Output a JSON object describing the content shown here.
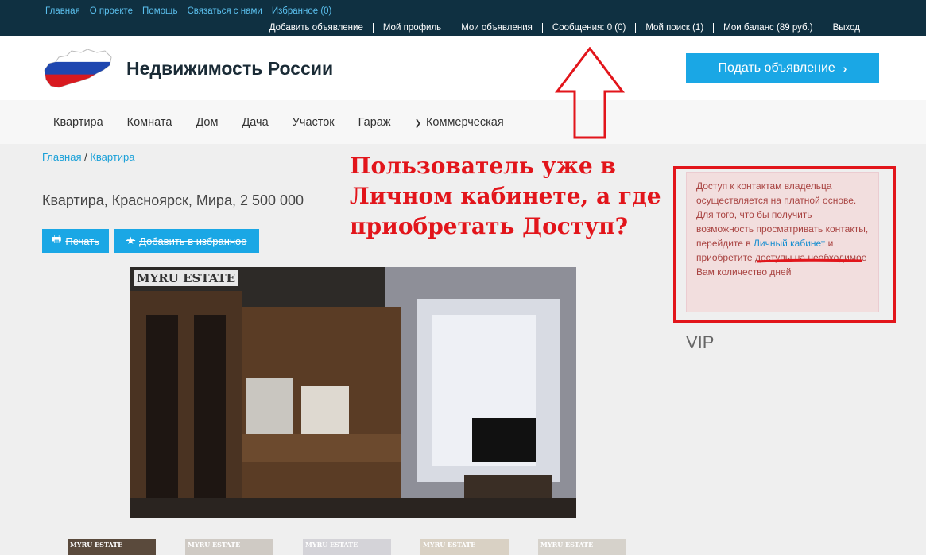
{
  "topbar": {
    "links": [
      "Главная",
      "О проекте",
      "Помощь",
      "Связаться с нами",
      "Избранное (0)"
    ],
    "user_menu": [
      "Добавить объявление",
      "Мой профиль",
      "Мои объявления",
      "Сообщения: 0 (0)",
      "Мой поиск (1)",
      "Мои баланс (89 руб.)",
      "Выход"
    ]
  },
  "header": {
    "site_title": "Недвижимость России",
    "post_button": "Подать объявление",
    "logo_icon": "russia-map-flag-logo"
  },
  "nav": {
    "items": [
      "Квартира",
      "Комната",
      "Дом",
      "Дача",
      "Участок",
      "Гараж"
    ],
    "dropdown_item": "Коммерческая"
  },
  "breadcrumb": {
    "home": "Главная",
    "separator": " / ",
    "current": "Квартира"
  },
  "listing": {
    "title": "Квартира, Красноярск, Мира, 2 500 000",
    "print_button": "Печать",
    "favorite_button": "Добавить в избранное",
    "watermark": "MYRU ESTATE"
  },
  "thumbnails": {
    "watermark": "MYRU ESTATE"
  },
  "annotation": {
    "text": "Пользователь уже в Личном кабинете, а где приобретать Доступ?"
  },
  "sidebar": {
    "alert_before": "Доступ к контактам владельца осуществляется на платной основе. Для того, что бы получить возможность просматривать контакты, перейдите в ",
    "alert_link": "Личный кабинет",
    "alert_after": " и приобретите доступы на необходимое Вам количество дней",
    "vip_label": "VIP"
  },
  "colors": {
    "topbar_bg": "#0f3041",
    "accent": "#1aa7e5",
    "annotation_red": "#e2151b",
    "alert_bg": "#f2dede"
  }
}
